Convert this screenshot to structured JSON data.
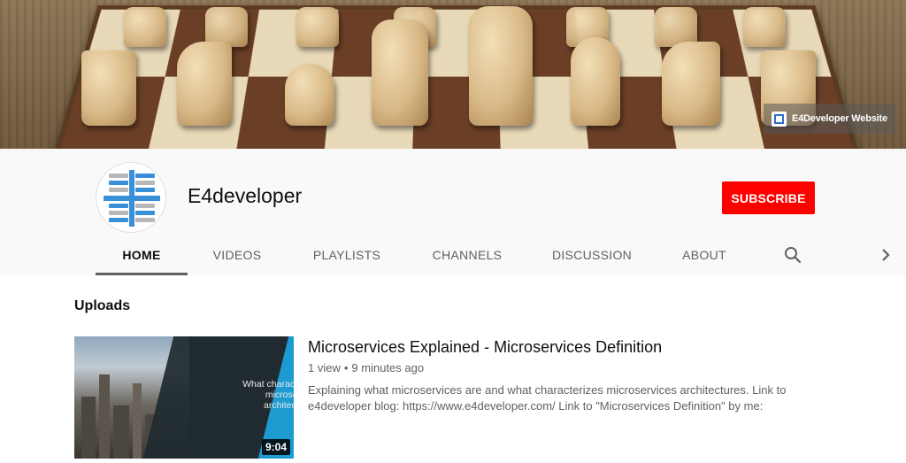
{
  "banner": {
    "site_link_label": "E4Developer Website"
  },
  "channel": {
    "name": "E4developer",
    "subscribe_label": "SUBSCRIBE"
  },
  "tabs": [
    {
      "label": "HOME",
      "active": true
    },
    {
      "label": "VIDEOS",
      "active": false
    },
    {
      "label": "PLAYLISTS",
      "active": false
    },
    {
      "label": "CHANNELS",
      "active": false
    },
    {
      "label": "DISCUSSION",
      "active": false
    },
    {
      "label": "ABOUT",
      "active": false
    }
  ],
  "icons": {
    "search": "search-icon",
    "next": "chevron-right-icon"
  },
  "uploads": {
    "section_title": "Uploads",
    "video": {
      "title": "Microservices Explained - Microservices Definition",
      "views": "1 view",
      "separator": "•",
      "age": "9 minutes ago",
      "description": "Explaining what microservices are and what characterizes microservices architectures. Link to e4developer blog: https://www.e4developer.com/ Link to \"Microservices Definition\" by me:",
      "thumbnail_text": "What characterizes microservices architectures?",
      "duration": "9:04"
    }
  },
  "colors": {
    "brand_red": "#ff0000",
    "avatar_blue": "#3a8fd9",
    "avatar_grey": "#b8b8b8",
    "thumb_accent": "#1d9bd1"
  }
}
